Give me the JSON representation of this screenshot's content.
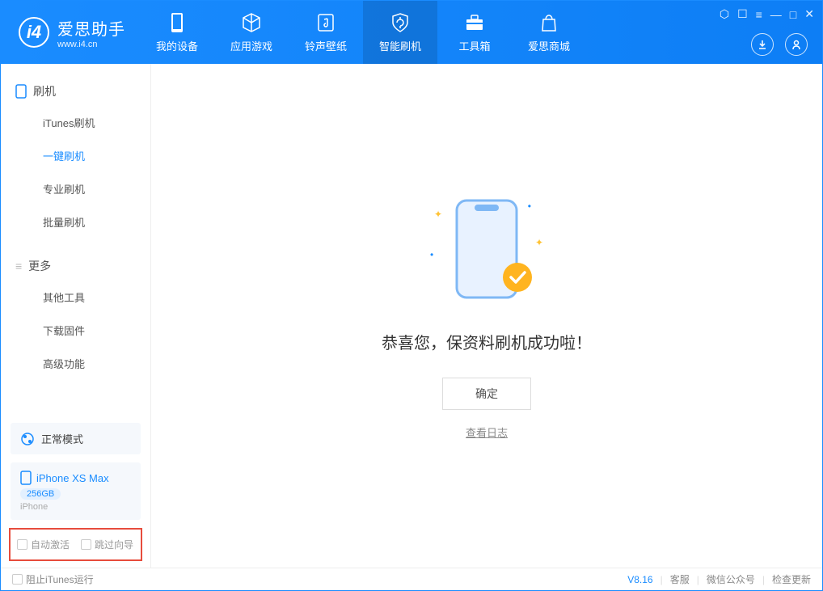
{
  "app": {
    "name": "爱思助手",
    "url": "www.i4.cn"
  },
  "tabs": [
    {
      "label": "我的设备"
    },
    {
      "label": "应用游戏"
    },
    {
      "label": "铃声壁纸"
    },
    {
      "label": "智能刷机"
    },
    {
      "label": "工具箱"
    },
    {
      "label": "爱思商城"
    }
  ],
  "sidebar": {
    "section1": {
      "title": "刷机",
      "items": [
        "iTunes刷机",
        "一键刷机",
        "专业刷机",
        "批量刷机"
      ]
    },
    "section2": {
      "title": "更多",
      "items": [
        "其他工具",
        "下载固件",
        "高级功能"
      ]
    }
  },
  "status": {
    "mode": "正常模式"
  },
  "device": {
    "name": "iPhone XS Max",
    "capacity": "256GB",
    "type": "iPhone"
  },
  "checks": {
    "auto_activate": "自动激活",
    "skip_guide": "跳过向导"
  },
  "main": {
    "success_msg": "恭喜您，保资料刷机成功啦！",
    "ok": "确定",
    "view_log": "查看日志"
  },
  "footer": {
    "block_itunes": "阻止iTunes运行",
    "version": "V8.16",
    "support": "客服",
    "wechat": "微信公众号",
    "check_update": "检查更新"
  }
}
